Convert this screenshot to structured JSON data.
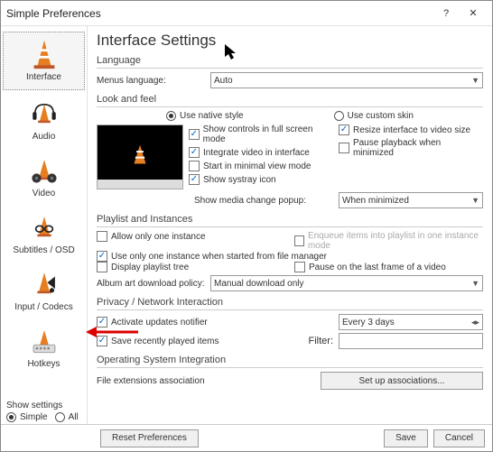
{
  "window": {
    "title": "Simple Preferences",
    "help": "?",
    "close": "✕"
  },
  "sidebar": {
    "items": [
      {
        "label": "Interface"
      },
      {
        "label": "Audio"
      },
      {
        "label": "Video"
      },
      {
        "label": "Subtitles / OSD"
      },
      {
        "label": "Input / Codecs"
      },
      {
        "label": "Hotkeys"
      }
    ]
  },
  "heading": "Interface Settings",
  "language": {
    "section": "Language",
    "menus_label": "Menus language:",
    "value": "Auto"
  },
  "look": {
    "section": "Look and feel",
    "native": "Use native style",
    "custom": "Use custom skin",
    "show_controls": "Show controls in full screen mode",
    "integrate": "Integrate video in interface",
    "minimal": "Start in minimal view mode",
    "systray": "Show systray icon",
    "resize": "Resize interface to video size",
    "pause_min": "Pause playback when minimized",
    "popup_label": "Show media change popup:",
    "popup_value": "When minimized"
  },
  "playlist": {
    "section": "Playlist and Instances",
    "one_instance": "Allow only one instance",
    "enqueue": "Enqueue items into playlist in one instance mode",
    "fm": "Use only one instance when started from file manager",
    "tree": "Display playlist tree",
    "pause_last": "Pause on the last frame of a video",
    "album_label": "Album art download policy:",
    "album_value": "Manual download only"
  },
  "privacy": {
    "section": "Privacy / Network Interaction",
    "updates": "Activate updates notifier",
    "updates_value": "Every 3 days",
    "recent": "Save recently played items",
    "filter_label": "Filter:"
  },
  "os": {
    "section": "Operating System Integration",
    "assoc_label": "File extensions association",
    "assoc_btn": "Set up associations..."
  },
  "show_settings": {
    "label": "Show settings",
    "simple": "Simple",
    "all": "All"
  },
  "footer": {
    "reset": "Reset Preferences",
    "save": "Save",
    "cancel": "Cancel"
  }
}
